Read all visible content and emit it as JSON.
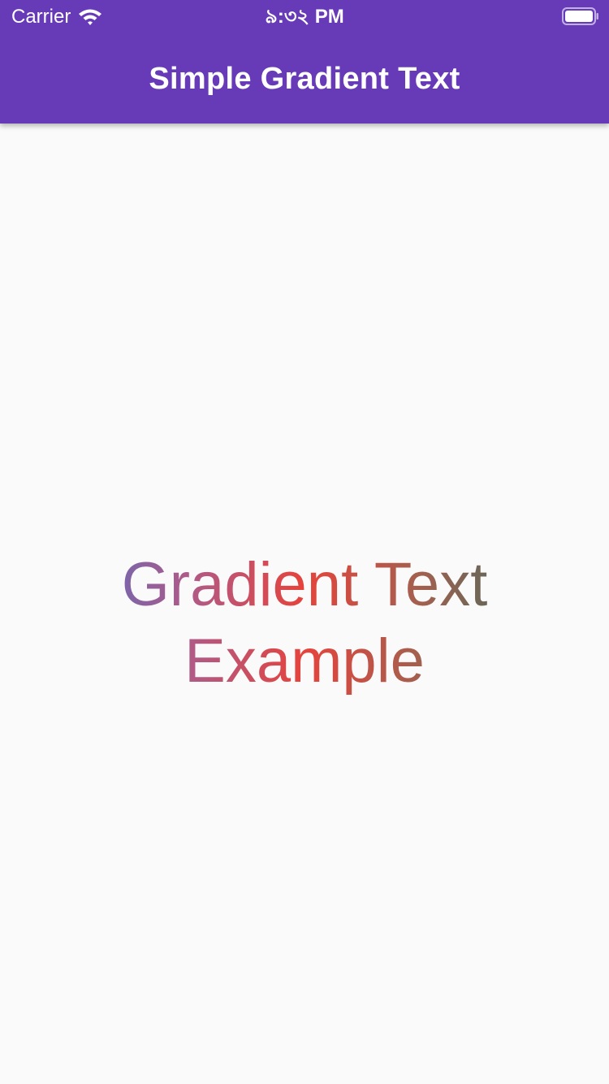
{
  "status_bar": {
    "carrier": "Carrier",
    "time": "৯:৩২ PM",
    "wifi_icon": "wifi-icon",
    "battery_icon": "battery-icon",
    "battery_level": 1.0
  },
  "app_bar": {
    "title": "Simple Gradient Text",
    "background_color": "#673ab7"
  },
  "main": {
    "gradient_text": "Gradient Text Example",
    "gradient_colors": [
      "#5c6bc0",
      "#b05a86",
      "#e5433c",
      "#a4604f",
      "#466b5d"
    ]
  }
}
